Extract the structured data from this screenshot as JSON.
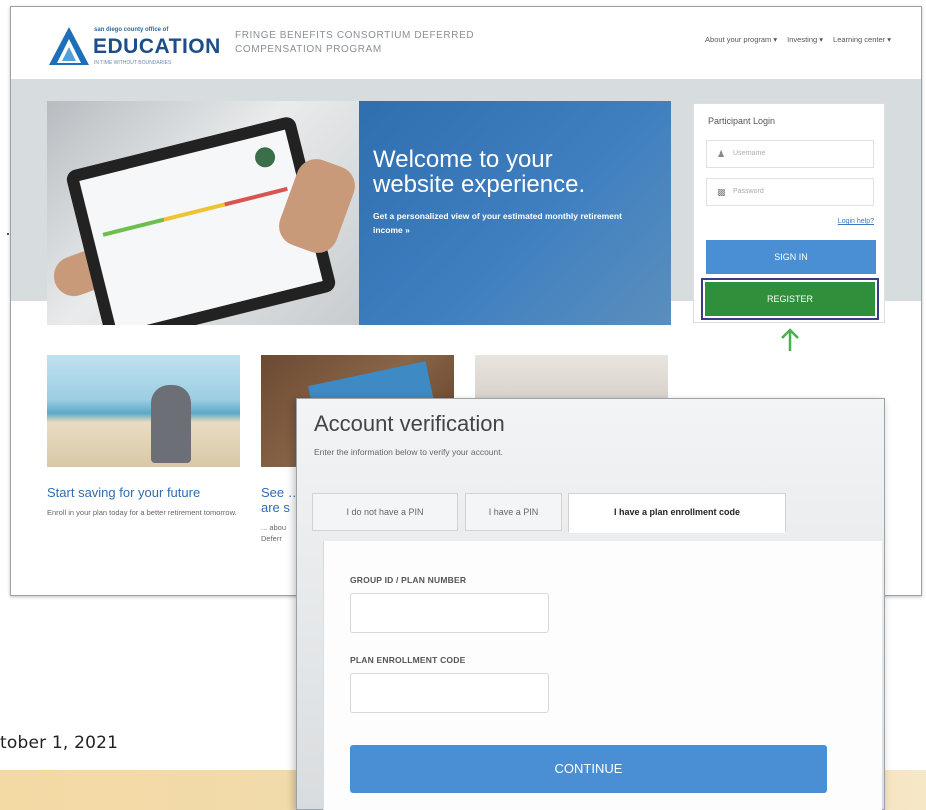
{
  "site": {
    "logo": {
      "small_text": "san diego county office of",
      "main_text": "EDUCATION",
      "tagline": "IN TIME WITHOUT BOUNDARIES"
    },
    "program_name": "FRINGE BENEFITS CONSORTIUM DEFERRED COMPENSATION PROGRAM",
    "nav": [
      {
        "label": "About your program ▾"
      },
      {
        "label": "Investing ▾"
      },
      {
        "label": "Learning center ▾"
      }
    ],
    "hero": {
      "title": "Welcome to your website experience.",
      "subtitle": "Get a personalized view of your estimated monthly retirement income »"
    },
    "login": {
      "title": "Participant Login",
      "username_placeholder": "Username",
      "password_placeholder": "Password",
      "help_link": "Login help?",
      "signin_label": "SIGN IN",
      "register_label": "REGISTER"
    },
    "cards": [
      {
        "title": "Start saving for your future",
        "text": "Enroll in your plan today for a better retirement tomorrow."
      },
      {
        "title": "See … are s",
        "text": "... abou Deferr"
      }
    ]
  },
  "modal": {
    "title": "Account verification",
    "subtitle": "Enter the information below to verify your account.",
    "tabs": [
      {
        "label": "I do not have a PIN",
        "active": false
      },
      {
        "label": "I have a PIN",
        "active": false
      },
      {
        "label": "I have a plan enrollment code",
        "active": true
      }
    ],
    "fields": [
      {
        "label": "GROUP ID / PLAN NUMBER",
        "value": ""
      },
      {
        "label": "PLAN ENROLLMENT CODE",
        "value": ""
      }
    ],
    "continue_label": "CONTINUE"
  },
  "page": {
    "date_text": "tober 1, 2021"
  },
  "colors": {
    "brand_blue": "#1d4e8a",
    "button_blue": "#4a8fd4",
    "register_green": "#2f8f3a",
    "highlight_outline": "#3b3c86",
    "arrow_green": "#4cae4c"
  }
}
